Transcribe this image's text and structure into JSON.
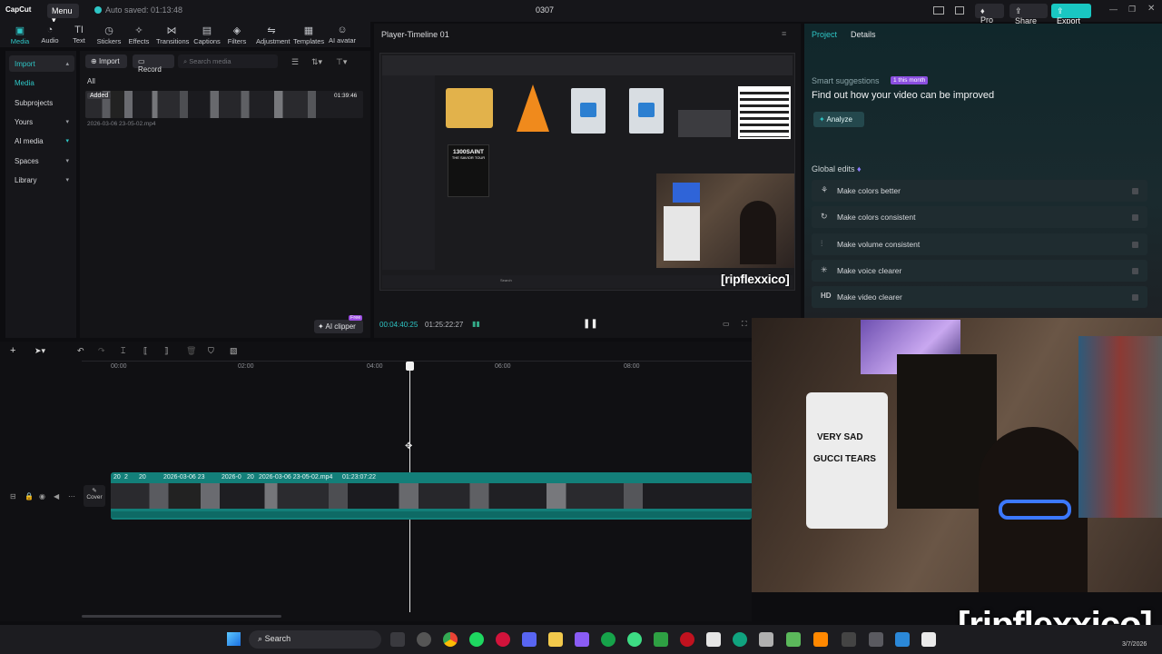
{
  "titlebar": {
    "app": "CapCut",
    "menu": "Menu",
    "autosave": "Auto saved: 01:13:48",
    "project": "0307",
    "pro": "Pro",
    "share": "Share",
    "export": "Export"
  },
  "toolbar": [
    {
      "label": "Media",
      "icon": "media-icon"
    },
    {
      "label": "Audio",
      "icon": "audio-icon"
    },
    {
      "label": "Text",
      "icon": "text-icon"
    },
    {
      "label": "Stickers",
      "icon": "stickers-icon"
    },
    {
      "label": "Effects",
      "icon": "effects-icon"
    },
    {
      "label": "Transitions",
      "icon": "transitions-icon"
    },
    {
      "label": "Captions",
      "icon": "captions-icon"
    },
    {
      "label": "Filters",
      "icon": "filters-icon"
    },
    {
      "label": "Adjustment",
      "icon": "adjustment-icon"
    },
    {
      "label": "Templates",
      "icon": "templates-icon"
    },
    {
      "label": "AI avatar",
      "icon": "ai-avatar-icon"
    }
  ],
  "sidebar": {
    "items": [
      "Import",
      "Media",
      "Subprojects",
      "Yours",
      "AI media",
      "Spaces",
      "Library"
    ]
  },
  "media": {
    "import": "Import",
    "record": "Record",
    "search_placeholder": "Search media",
    "filter": "All",
    "clip_badge": "Added",
    "clip_duration": "01:39:46",
    "clip_name": "2026-03-06 23-05-02.mp4",
    "ai_clipper": "AI clipper",
    "free": "Free"
  },
  "player": {
    "title": "Player-Timeline 01",
    "current": "00:04:40:25",
    "total": "01:25:22:27",
    "watermark": "[ripflexxico]"
  },
  "embedded": {
    "search": "Search",
    "poster_title": "1300SAINT",
    "poster_sub": "THE SAVIOR TOUR"
  },
  "right": {
    "tab_project": "Project",
    "tab_details": "Details",
    "smart": "Smart suggestions",
    "badge": "1 this month",
    "headline": "Find out how your video can be improved",
    "analyze": "Analyze",
    "global": "Global edits",
    "suggestions": [
      {
        "label": "Make colors better",
        "icon": "wand-icon"
      },
      {
        "label": "Make colors consistent",
        "icon": "refresh-icon"
      },
      {
        "label": "Make volume consistent",
        "icon": "sliders-icon"
      },
      {
        "label": "Make voice clearer",
        "icon": "sparkle-icon"
      },
      {
        "label": "Make video clearer",
        "icon": "hd-icon"
      }
    ]
  },
  "timeline": {
    "ticks": [
      "00:00",
      "02:00",
      "04:00",
      "06:00",
      "08:00"
    ],
    "cover": "Cover",
    "clip_a": "20",
    "clip_b": "2",
    "clip_c": "20",
    "clip_d": "2026-03-06 23",
    "clip_e": "2026-0",
    "clip_f": "20",
    "clip_main": "2026-03-06 23-05-02.mp4",
    "clip_main_dur": "01:23:07:22"
  },
  "webcam": {
    "shirt1": "VERY SAD",
    "shirt2": "GUCCI TEARS"
  },
  "overlay": {
    "tag": "[ripflexxico]",
    "date": "3/7/2026"
  },
  "taskbar": {
    "search": "Search"
  }
}
